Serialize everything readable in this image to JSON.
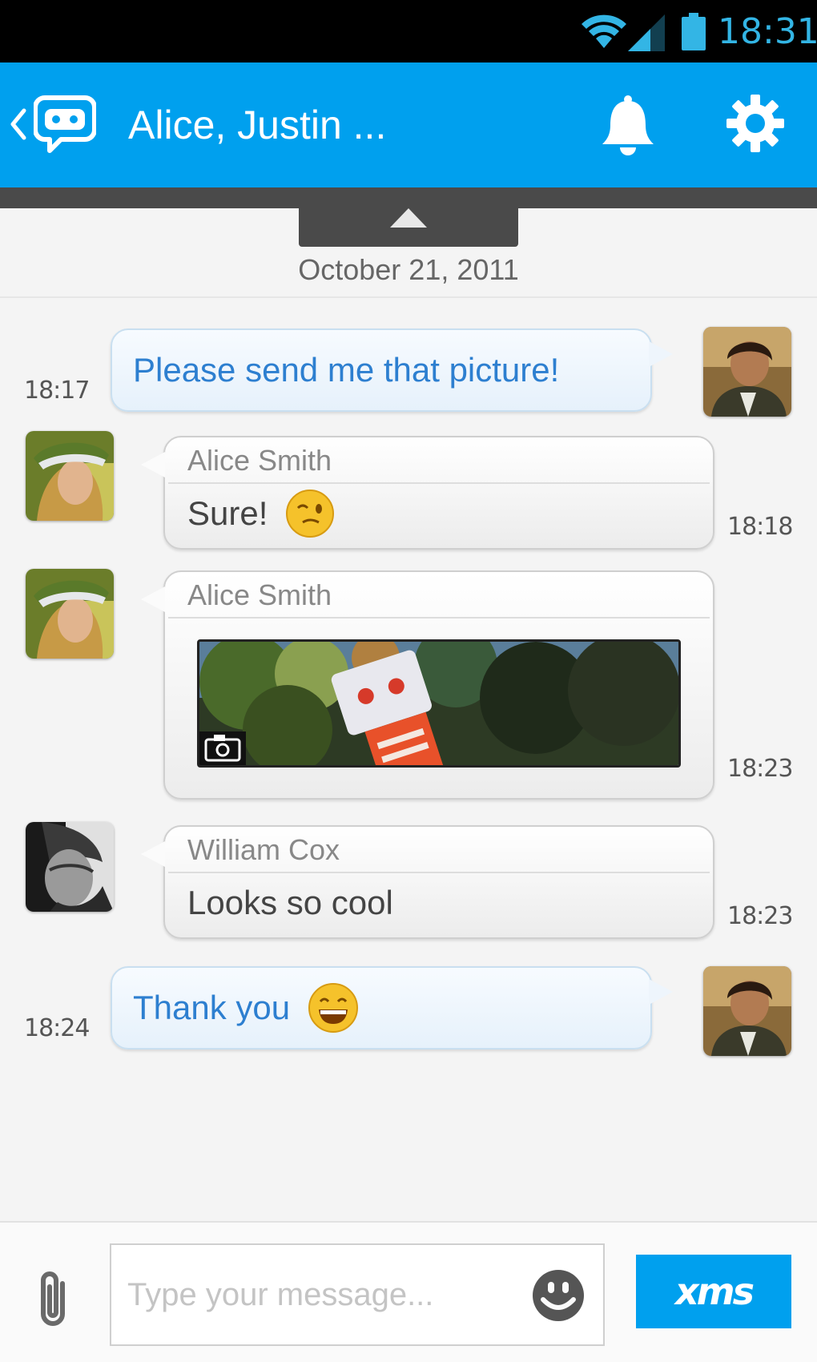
{
  "status_bar": {
    "time": "18:31"
  },
  "header": {
    "title": "Alice, Justin ..."
  },
  "conversation": {
    "date": "October 21, 2011",
    "messages": [
      {
        "direction": "outgoing",
        "text": "Please send me that picture!",
        "time": "18:17"
      },
      {
        "direction": "incoming",
        "sender": "Alice Smith",
        "text": "Sure!",
        "time": "18:18"
      },
      {
        "direction": "incoming",
        "sender": "Alice Smith",
        "attachment": "photo",
        "time": "18:23"
      },
      {
        "direction": "incoming",
        "sender": "William Cox",
        "text": "Looks so cool",
        "time": "18:23"
      },
      {
        "direction": "outgoing",
        "text": "Thank you",
        "time": "18:24"
      }
    ]
  },
  "composer": {
    "placeholder": "Type your message...",
    "send_label": "xms"
  },
  "colors": {
    "brand_blue": "#00a0ee",
    "outgoing_text": "#2d7fd0",
    "status_clock": "#33b5e5"
  },
  "icons": {
    "status": [
      "wifi-icon",
      "signal-icon",
      "battery-icon"
    ],
    "header": [
      "back-chevron-icon",
      "app-logo-icon",
      "bell-icon",
      "gear-icon"
    ],
    "composer": [
      "paperclip-icon",
      "smiley-icon"
    ],
    "photo": "camera-icon"
  }
}
